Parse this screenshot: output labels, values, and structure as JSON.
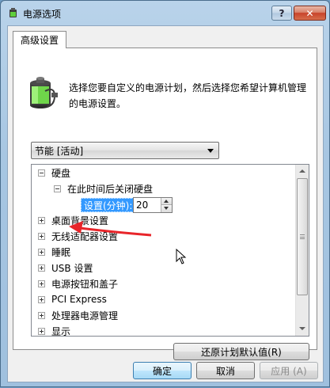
{
  "window": {
    "title": "电源选项",
    "help_label": "?",
    "close_label": "✕"
  },
  "tab": {
    "label": "高级设置"
  },
  "description": "选择您要自定义的电源计划，然后选择您希望计算机管理的电源设置。",
  "plan_select": {
    "value": "节能 [活动]"
  },
  "tree": {
    "harddisk": "硬盘",
    "turn_off_after": "在此时间后关闭硬盘",
    "setting_label": "设置(分钟):",
    "setting_value": "20",
    "items": [
      "桌面背景设置",
      "无线适配器设置",
      "睡眠",
      "USB 设置",
      "电源按钮和盖子",
      "PCI Express",
      "处理器电源管理",
      "显示"
    ]
  },
  "buttons": {
    "restore": "还原计划默认值(R)",
    "ok": "确定",
    "cancel": "取消",
    "apply": "应用 (A)"
  },
  "colors": {
    "selection": "#3399ff",
    "annotation_arrow": "#e8252a"
  }
}
